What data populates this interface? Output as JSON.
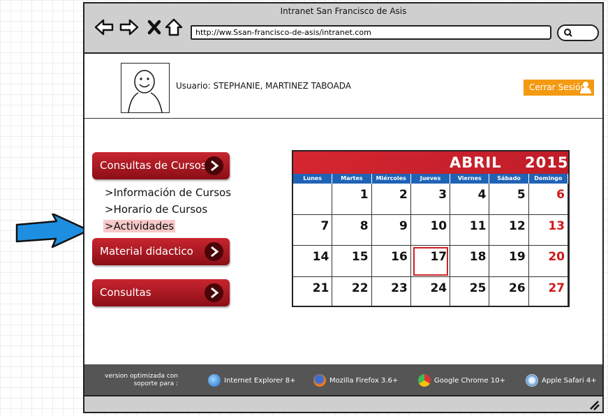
{
  "window": {
    "title": "Intranet San Francisco de Asis",
    "url": "http://ww.Ssan-francisco-de-asis/intranet.com"
  },
  "header": {
    "user_text": "Usuario: STEPHANIE, MARTINEZ TABOADA",
    "logout_label": "Cerrar Sesión"
  },
  "menu": {
    "consultas_cursos": "Consultas de Cursos",
    "sub_items": [
      ">Información de Cursos",
      ">Horario de Cursos",
      ">Actividades"
    ],
    "material": "Material didactico",
    "consultas": "Consultas"
  },
  "calendar": {
    "month": "ABRIL",
    "year": "2015",
    "days_of_week": [
      "Lunes",
      "Martes",
      "Miércoles",
      "Jueves",
      "Viernes",
      "Sábado",
      "Domingo"
    ],
    "weeks": [
      [
        "",
        "1",
        "2",
        "3",
        "4",
        "5",
        "6"
      ],
      [
        "7",
        "8",
        "9",
        "10",
        "11",
        "12",
        "13"
      ],
      [
        "14",
        "15",
        "16",
        "17",
        "18",
        "19",
        "20"
      ],
      [
        "21",
        "22",
        "23",
        "24",
        "25",
        "26",
        "27"
      ]
    ],
    "highlighted_day": "17",
    "colors": {
      "header": "#d42631",
      "dow": "#1f63b5",
      "sunday": "#d01818",
      "today": "#cc2222"
    }
  },
  "footer": {
    "note": "version optimizada con soporte para :",
    "browsers": [
      {
        "name": "Internet Explorer 8+",
        "icon": "internet-explorer-icon"
      },
      {
        "name": "Mozilla Firefox 3.6+",
        "icon": "firefox-icon"
      },
      {
        "name": "Google Chrome 10+",
        "icon": "chrome-icon"
      },
      {
        "name": "Apple Safari 4+",
        "icon": "safari-icon"
      }
    ]
  },
  "colors": {
    "menu_button": "#a8141e",
    "logout": "#f39a12",
    "footer": "#555555",
    "active_sub": "#f7c8c8",
    "pointer_arrow": "#1e8fe0"
  }
}
